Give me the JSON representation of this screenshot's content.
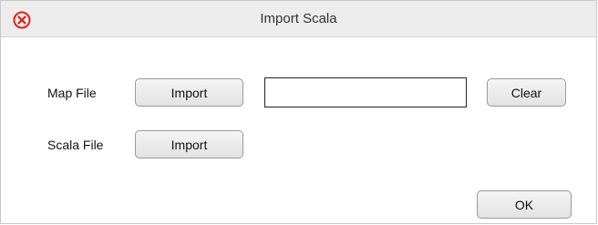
{
  "window": {
    "title": "Import Scala"
  },
  "icons": {
    "close": "close-circle-icon",
    "close_color": "#e0201b"
  },
  "map_file": {
    "label": "Map File",
    "import_label": "Import",
    "path_value": "",
    "clear_label": "Clear"
  },
  "scala_file": {
    "label": "Scala File",
    "import_label": "Import"
  },
  "footer": {
    "ok_label": "OK"
  }
}
